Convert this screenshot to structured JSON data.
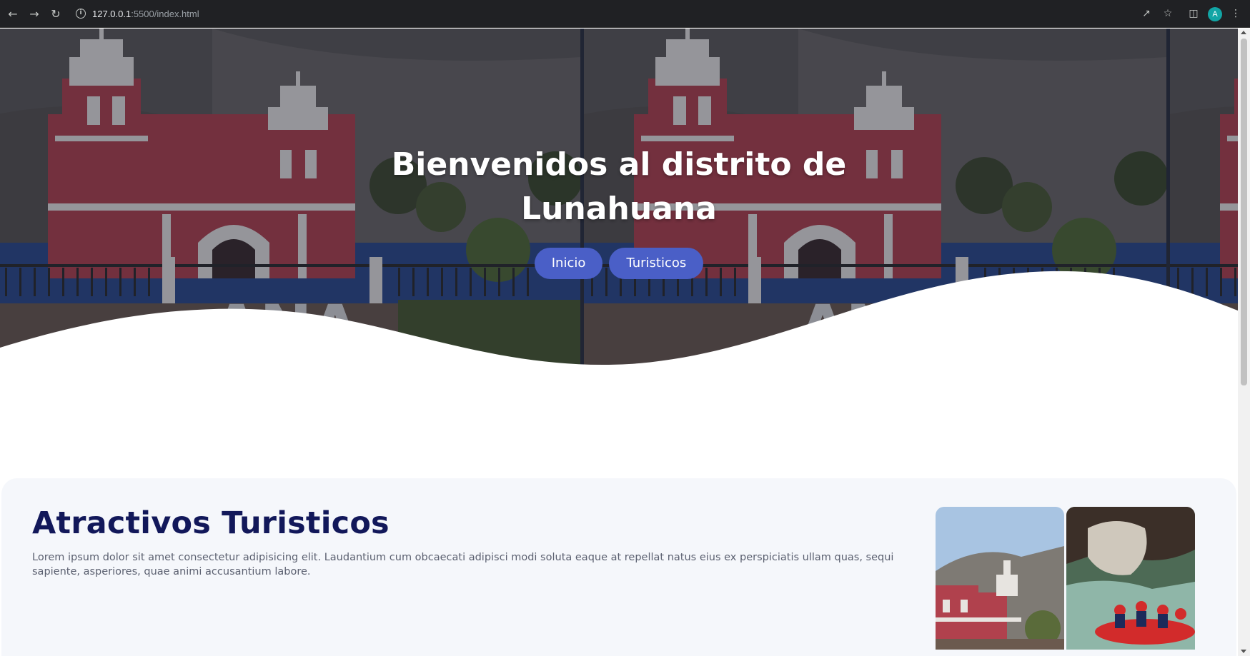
{
  "browser": {
    "url_host": "127.0.0.1",
    "url_rest": ":5500/index.html",
    "avatar_letter": "A"
  },
  "hero": {
    "title_line1": "Bienvenidos al distrito de",
    "title_line2": "Lunahuana",
    "nav": [
      {
        "label": "Inicio"
      },
      {
        "label": "Turisticos"
      }
    ],
    "sign_text": "LUNAHUANA"
  },
  "section": {
    "title": "Atractivos Turisticos",
    "text": "Lorem ipsum dolor sit amet consectetur adipisicing elit. Laudantium cum obcaecati adipisci modi soluta eaque at repellat natus eius ex perspiciatis ullam quas, sequi sapiente, asperiores, quae animi accusantium labore."
  },
  "colors": {
    "accent": "#4a5fc7",
    "title": "#12185a",
    "section_bg": "#f5f7fb",
    "church_red": "#b0414d"
  }
}
